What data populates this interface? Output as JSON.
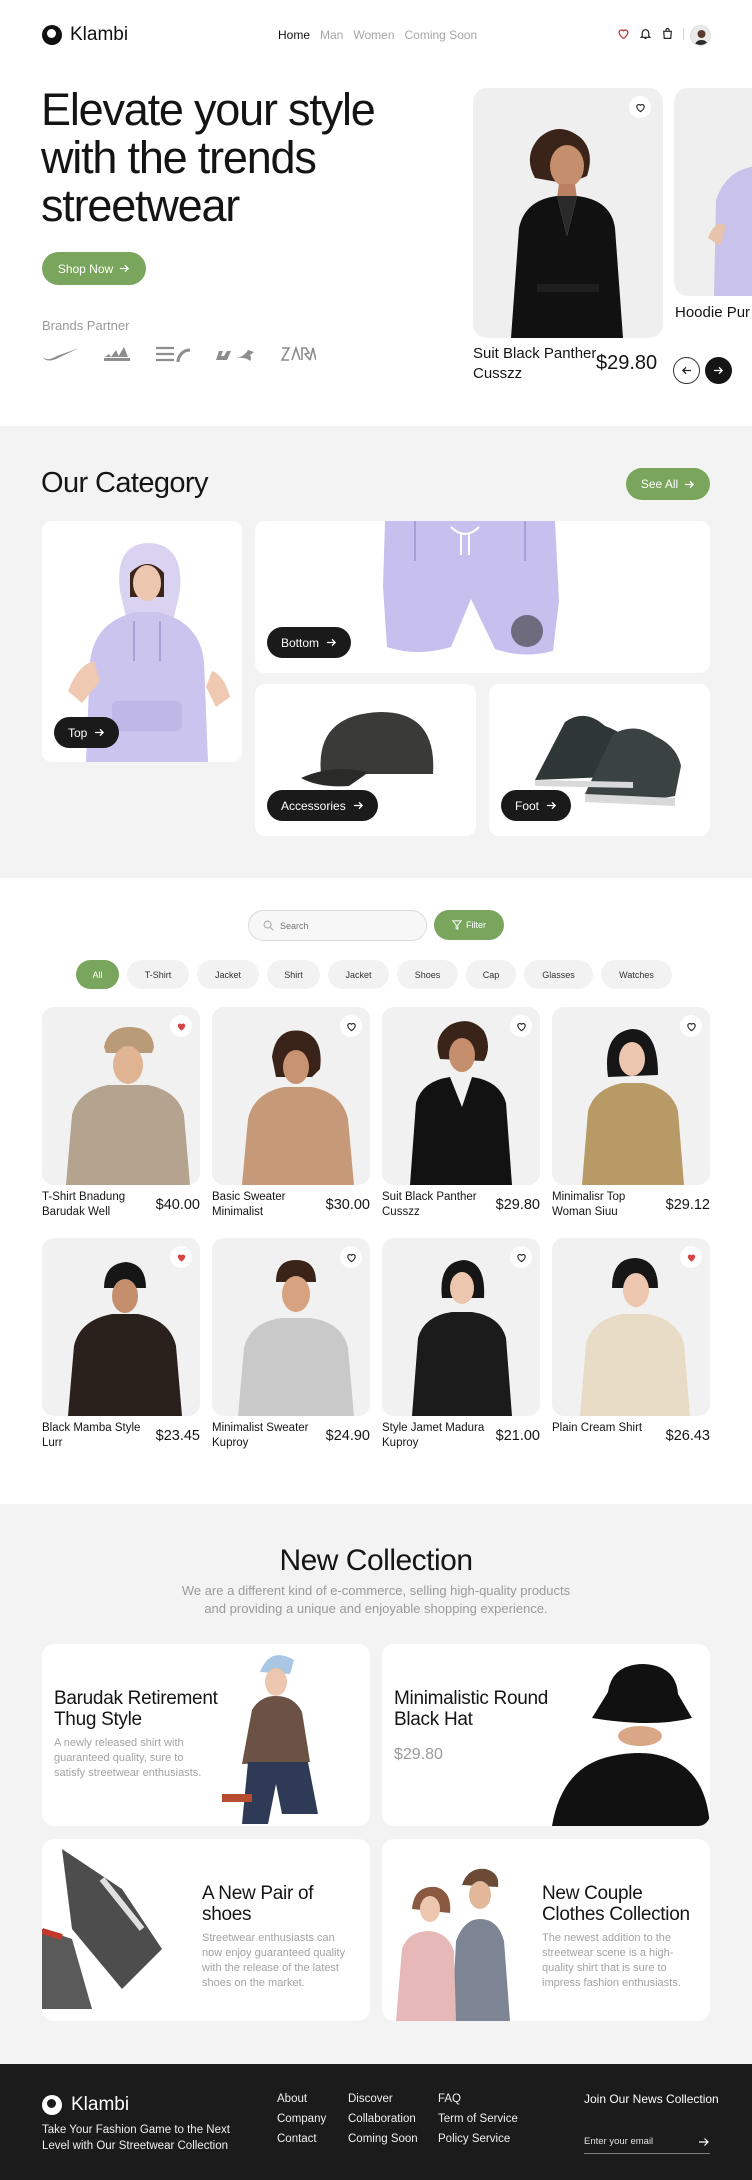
{
  "nav": {
    "brand": "Klambi",
    "menu": [
      "Home",
      "Man",
      "Women",
      "Coming Soon"
    ],
    "active_menu": "Home"
  },
  "hero": {
    "title": "Elevate your style with the trends streetwear",
    "cta": "Shop Now",
    "brands_label": "Brands Partner",
    "brands": [
      "nike-logo",
      "adidas-logo",
      "the-north-face-logo",
      "puma-logo",
      "zara-logo"
    ],
    "featured": {
      "name": "Suit Black Panther Cusszz",
      "price": "$29.80"
    },
    "next_featured": {
      "name": "Hoodie Pur Sweetie"
    }
  },
  "category": {
    "title": "Our Category",
    "see_all": "See All",
    "items": [
      {
        "label": "Top"
      },
      {
        "label": "Bottom"
      },
      {
        "label": "Accessories"
      },
      {
        "label": "Foot"
      }
    ]
  },
  "products": {
    "search_placeholder": "Search",
    "filter_label": "Filter",
    "chips": [
      "All",
      "T-Shirt",
      "Jacket",
      "Shirt",
      "Jacket",
      "Shoes",
      "Cap",
      "Glasses",
      "Watches"
    ],
    "active_chip": "All",
    "items": [
      {
        "name": "T-Shirt Bnadung Barudak Well",
        "price": "$40.00",
        "liked": true
      },
      {
        "name": "Basic Sweater Minimalist",
        "price": "$30.00",
        "liked": false
      },
      {
        "name": "Suit Black Panther Cusszz",
        "price": "$29.80",
        "liked": false
      },
      {
        "name": "Minimalisr Top Woman Siuu",
        "price": "$29.12",
        "liked": false
      },
      {
        "name": "Black Mamba Style Lurr",
        "price": "$23.45",
        "liked": true
      },
      {
        "name": "Minimalist Sweater Kuproy",
        "price": "$24.90",
        "liked": false
      },
      {
        "name": "Style Jamet Madura Kuproy",
        "price": "$21.00",
        "liked": false
      },
      {
        "name": "Plain Cream Shirt",
        "price": "$26.43",
        "liked": true
      }
    ]
  },
  "collection": {
    "title": "New Collection",
    "subtitle": "We are a different kind of e-commerce, selling high-quality products and providing a unique and enjoyable shopping experience.",
    "cards": [
      {
        "title": "Barudak Retirement Thug Style",
        "desc": "A newly released shirt with guaranteed quality, sure to satisfy streetwear enthusiasts."
      },
      {
        "title": "Minimalistic Round Black Hat",
        "price": "$29.80"
      },
      {
        "title": "A New Pair of shoes",
        "desc": "Streetwear enthusiasts can now enjoy guaranteed quality with the release of the latest shoes on the market."
      },
      {
        "title": "New Couple Clothes Collection",
        "desc": "The newest addition to the streetwear scene is a high-quality shirt that is sure to impress fashion enthusiasts."
      }
    ]
  },
  "footer": {
    "brand": "Klambi",
    "tagline": "Take Your Fashion Game to the Next Level with Our Streetwear Collection",
    "col1": [
      "About",
      "Company",
      "Contact"
    ],
    "col2": [
      "Discover",
      "Collaboration",
      "Coming Soon"
    ],
    "col3": [
      "FAQ",
      "Term of Service",
      "Policy Service"
    ],
    "newsletter_title": "Join Our News Collection",
    "email_placeholder": "Enter your email"
  },
  "colors": {
    "accent": "#79a55c",
    "dark": "#1b1b1b",
    "section_bg": "#f3f3f3",
    "heart_red": "#d64545"
  }
}
